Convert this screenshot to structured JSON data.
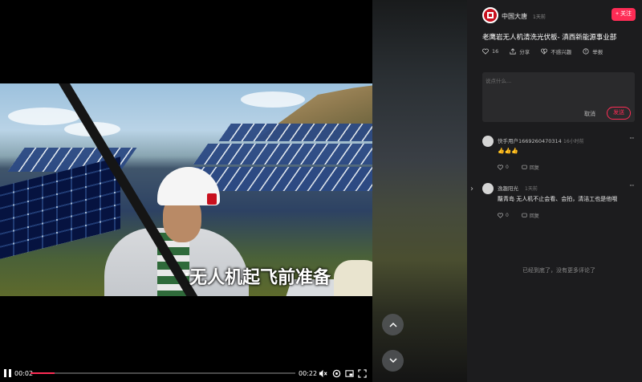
{
  "video": {
    "subtitle": "无人机起飞前准备",
    "time_current": "00:02",
    "time_total": "00:22",
    "progress": 0.09
  },
  "author": {
    "name": "中国大唐",
    "time": "1天前",
    "follow_label": "+ 关注"
  },
  "post": {
    "title": "老鹰岩无人机清洗光伏板- 滇西新能源事业部",
    "actions": {
      "likes": "16",
      "share": "分享",
      "not_interested": "不感兴趣",
      "report": "举报"
    }
  },
  "comment_input": {
    "placeholder": "说点什么...",
    "cancel_label": "取消",
    "send_label": "发送"
  },
  "comments": [
    {
      "user": "快手用户1669260470314",
      "time": "16小时前",
      "text": "👍👍👍",
      "likes": "0",
      "reply_label": "回复"
    },
    {
      "user": "逸趣阳光",
      "time": "1天前",
      "text": "黻青岛 无人机不止会看、会拍，清洁工也是他哦",
      "likes": "0",
      "reply_label": "回复"
    }
  ],
  "end_message": "已经到底了，没有更多评论了",
  "colors": {
    "accent": "#fe2c55",
    "panel_bg": "#1c1c1e",
    "brand_red": "#c8101e"
  }
}
